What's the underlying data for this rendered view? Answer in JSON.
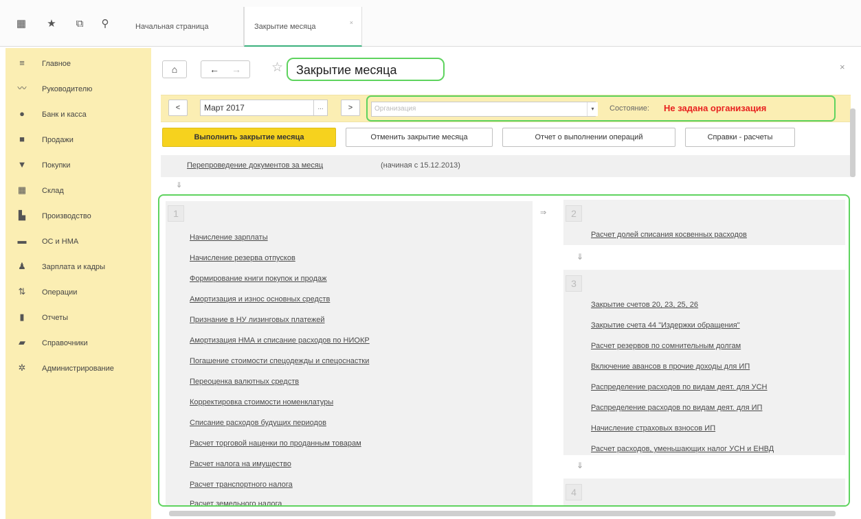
{
  "topbar": {
    "icons": [
      "apps-grid-icon",
      "star-icon",
      "history-icon",
      "search-icon"
    ],
    "tabs": [
      {
        "label": "Начальная страница"
      },
      {
        "label": "Закрытие месяца",
        "close": "×"
      }
    ]
  },
  "sidebar": {
    "items": [
      {
        "label": "Главное",
        "icon": "menu-icon"
      },
      {
        "label": "Руководителю",
        "icon": "chart-line-icon"
      },
      {
        "label": "Банк и касса",
        "icon": "bank-icon"
      },
      {
        "label": "Продажи",
        "icon": "bag-icon"
      },
      {
        "label": "Покупки",
        "icon": "cart-icon"
      },
      {
        "label": "Склад",
        "icon": "warehouse-icon"
      },
      {
        "label": "Производство",
        "icon": "factory-icon"
      },
      {
        "label": "ОС и НМА",
        "icon": "truck-icon"
      },
      {
        "label": "Зарплата и кадры",
        "icon": "person-icon"
      },
      {
        "label": "Операции",
        "icon": "operations-icon"
      },
      {
        "label": "Отчеты",
        "icon": "bar-chart-icon"
      },
      {
        "label": "Справочники",
        "icon": "book-icon"
      },
      {
        "label": "Администрирование",
        "icon": "gear-icon"
      }
    ]
  },
  "header": {
    "title": "Закрытие месяца",
    "back": "←",
    "forward": "→",
    "home": "⌂",
    "close": "×"
  },
  "filter": {
    "prev": "<",
    "next": ">",
    "month": "Март 2017",
    "month_picker": "...",
    "org_placeholder": "Организация",
    "state_label": "Состояние:",
    "state_value": "Не задана организация"
  },
  "actions": {
    "close_month": "Выполнить закрытие месяца",
    "cancel_close": "Отменить закрытие месяца",
    "report": "Отчет о выполнении операций",
    "help": "Справки - расчеты"
  },
  "repost": {
    "link": "Перепроведение документов за месяц",
    "hint": "(начиная с 15.12.2013)"
  },
  "stages": [
    {
      "num": "1",
      "ops": [
        "Начисление зарплаты",
        "Начисление резерва отпусков",
        "Формирование книги покупок и продаж",
        "Амортизация и износ основных средств",
        "Признание в НУ лизинговых платежей",
        "Амортизация НМА и списание расходов по НИОКР",
        "Погашение стоимости спецодежды и спецоснастки",
        "Переоценка валютных средств",
        "Корректировка стоимости номенклатуры",
        "Списание расходов будущих периодов",
        "Расчет торговой наценки по проданным товарам",
        "Расчет налога на имущество",
        "Расчет транспортного налога",
        "Расчет земельного налога"
      ]
    },
    {
      "num": "2",
      "ops": [
        "Расчет долей списания косвенных расходов"
      ]
    },
    {
      "num": "3",
      "ops": [
        "Закрытие счетов 20, 23, 25, 26",
        "Закрытие счета 44 \"Издержки обращения\"",
        "Расчет резервов по сомнительным долгам",
        "Включение авансов в прочие доходы для ИП",
        "Распределение расходов по видам деят. для УСН",
        "Распределение расходов по видам деят. для ИП",
        "Начисление страховых взносов ИП",
        "Расчет расходов, уменьшающих налог УСН и ЕНВД"
      ]
    },
    {
      "num": "4",
      "ops": []
    }
  ],
  "arrows": {
    "down": "⇓",
    "right": "⇒"
  }
}
